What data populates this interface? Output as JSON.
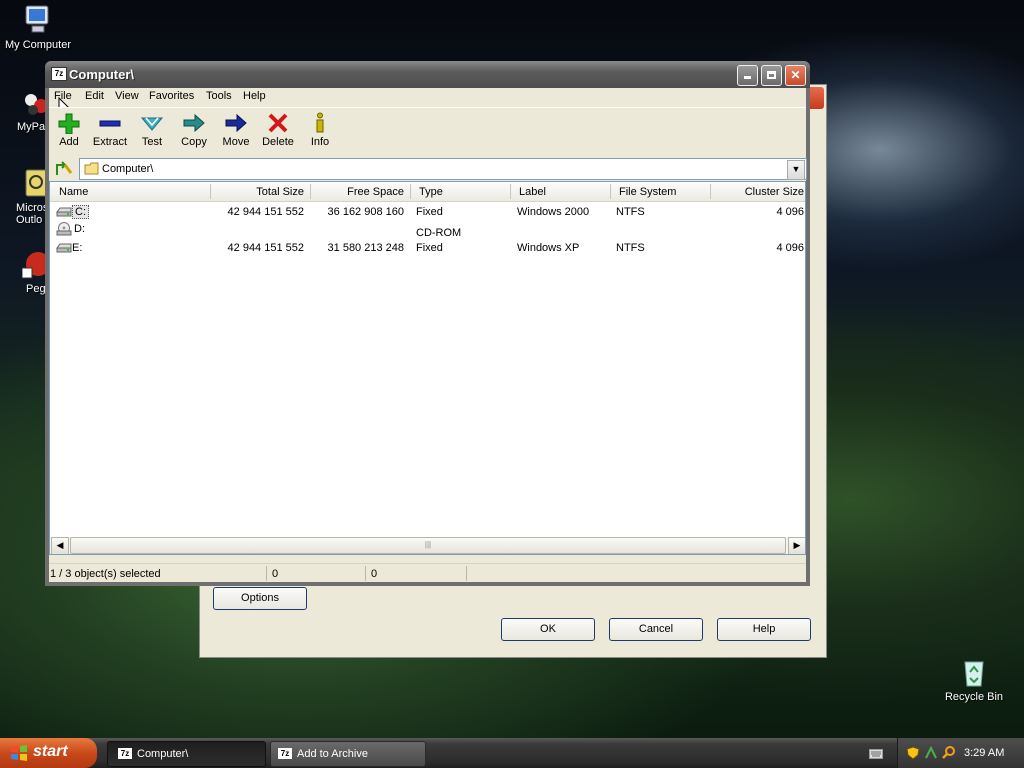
{
  "desktop": {
    "icons": [
      {
        "label": "My Computer"
      },
      {
        "label": "MyPa"
      },
      {
        "label": "Micros Outlo"
      },
      {
        "label": "Peg"
      },
      {
        "label": "Recycle Bin"
      }
    ]
  },
  "back_dialog": {
    "options_label": "Options",
    "ok_label": "OK",
    "cancel_label": "Cancel",
    "help_label": "Help"
  },
  "window": {
    "title": "Computer\\",
    "icon_text": "7z",
    "menu": [
      "File",
      "Edit",
      "View",
      "Favorites",
      "Tools",
      "Help"
    ],
    "toolbar": [
      {
        "label": "Add",
        "icon": "add-icon",
        "color": "#22b022"
      },
      {
        "label": "Extract",
        "icon": "extract-icon",
        "color": "#1f2fb0"
      },
      {
        "label": "Test",
        "icon": "test-icon",
        "color": "#3fb0c8"
      },
      {
        "label": "Copy",
        "icon": "copy-icon",
        "color": "#2a8a8a"
      },
      {
        "label": "Move",
        "icon": "move-icon",
        "color": "#1a2a9a"
      },
      {
        "label": "Delete",
        "icon": "delete-icon",
        "color": "#d01818"
      },
      {
        "label": "Info",
        "icon": "info-icon",
        "color": "#c8b800"
      }
    ],
    "address": "Computer\\",
    "columns": [
      "Name",
      "Total Size",
      "Free Space",
      "Type",
      "Label",
      "File System",
      "Cluster Size"
    ],
    "rows": [
      {
        "name": "C:",
        "total": "42 944 151 552",
        "free": "36 162 908 160",
        "type": "Fixed",
        "label": "Windows 2000",
        "fs": "NTFS",
        "cluster": "4 096",
        "selected": true,
        "icon": "hard-drive-icon"
      },
      {
        "name": "D:",
        "total": "",
        "free": "",
        "type": "CD-ROM",
        "label": "",
        "fs": "",
        "cluster": "",
        "selected": false,
        "icon": "cdrom-drive-icon"
      },
      {
        "name": "E:",
        "total": "42 944 151 552",
        "free": "31 580 213 248",
        "type": "Fixed",
        "label": "Windows XP",
        "fs": "NTFS",
        "cluster": "4 096",
        "selected": false,
        "icon": "hard-drive-icon"
      }
    ],
    "status": {
      "selection": "1 / 3 object(s) selected",
      "size": "0",
      "packed": "0"
    }
  },
  "taskbar": {
    "start_label": "start",
    "tasks": [
      {
        "label": "Computer\\",
        "icon_text": "7z",
        "active": true
      },
      {
        "label": "Add to Archive",
        "icon_text": "7z",
        "active": false
      }
    ],
    "clock": "3:29 AM"
  }
}
